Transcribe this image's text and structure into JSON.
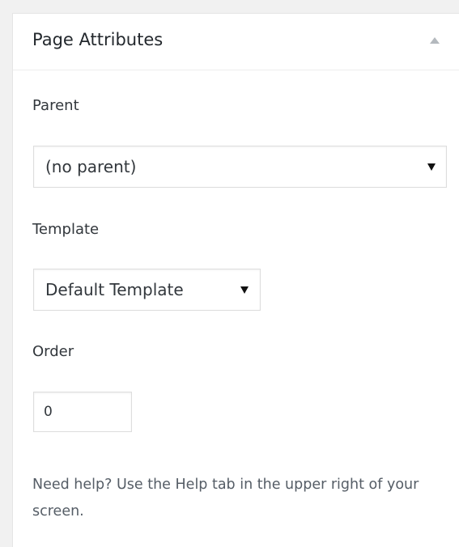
{
  "panel": {
    "title": "Page Attributes",
    "toggle_icon": "arrow-up-icon"
  },
  "parent": {
    "label": "Parent",
    "selected": "(no parent)",
    "caret_icon": "caret-down-icon"
  },
  "template": {
    "label": "Template",
    "selected": "Default Template",
    "caret_icon": "caret-down-icon"
  },
  "order": {
    "label": "Order",
    "value": "0"
  },
  "help": {
    "text": "Need help? Use the Help tab in the upper right of your screen."
  }
}
